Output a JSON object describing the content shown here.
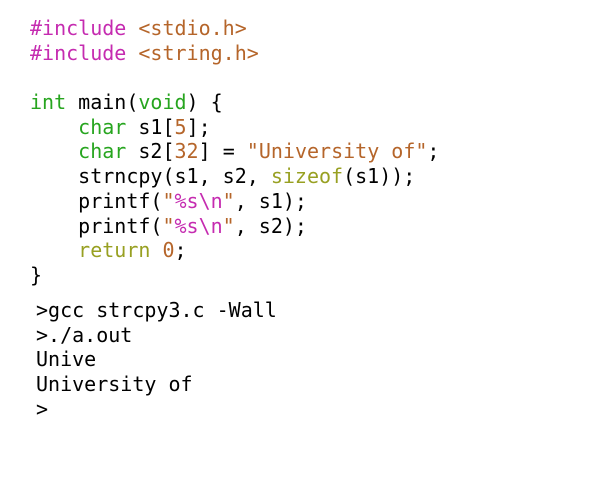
{
  "colors": {
    "preprocessor": "#c52bb0",
    "header": "#b5652a",
    "type": "#27a51f",
    "keyword": "#98a022",
    "string": "#b5652a",
    "escape": "#c52bb0",
    "number": "#b5652a",
    "text": "#000000",
    "background": "#ffffff"
  },
  "code": {
    "lines": [
      [
        {
          "kind": "preproc",
          "text": "#include "
        },
        {
          "kind": "header",
          "text": "<stdio.h>"
        }
      ],
      [
        {
          "kind": "preproc",
          "text": "#include "
        },
        {
          "kind": "header",
          "text": "<string.h>"
        }
      ],
      [],
      [
        {
          "kind": "type",
          "text": "int"
        },
        {
          "kind": "plain",
          "text": " main("
        },
        {
          "kind": "type",
          "text": "void"
        },
        {
          "kind": "plain",
          "text": ") {"
        }
      ],
      [
        {
          "kind": "plain",
          "text": "    "
        },
        {
          "kind": "type",
          "text": "char"
        },
        {
          "kind": "plain",
          "text": " s1["
        },
        {
          "kind": "number",
          "text": "5"
        },
        {
          "kind": "plain",
          "text": "];"
        }
      ],
      [
        {
          "kind": "plain",
          "text": "    "
        },
        {
          "kind": "type",
          "text": "char"
        },
        {
          "kind": "plain",
          "text": " s2["
        },
        {
          "kind": "number",
          "text": "32"
        },
        {
          "kind": "plain",
          "text": "] = "
        },
        {
          "kind": "string",
          "text": "\"University of\""
        },
        {
          "kind": "plain",
          "text": ";"
        }
      ],
      [
        {
          "kind": "plain",
          "text": "    strncpy(s1, s2, "
        },
        {
          "kind": "keyword",
          "text": "sizeof"
        },
        {
          "kind": "plain",
          "text": "(s1));"
        }
      ],
      [
        {
          "kind": "plain",
          "text": "    printf("
        },
        {
          "kind": "string",
          "text": "\""
        },
        {
          "kind": "escape",
          "text": "%s\\n"
        },
        {
          "kind": "string",
          "text": "\""
        },
        {
          "kind": "plain",
          "text": ", s1);"
        }
      ],
      [
        {
          "kind": "plain",
          "text": "    printf("
        },
        {
          "kind": "string",
          "text": "\""
        },
        {
          "kind": "escape",
          "text": "%s\\n"
        },
        {
          "kind": "string",
          "text": "\""
        },
        {
          "kind": "plain",
          "text": ", s2);"
        }
      ],
      [
        {
          "kind": "plain",
          "text": "    "
        },
        {
          "kind": "keyword",
          "text": "return"
        },
        {
          "kind": "plain",
          "text": " "
        },
        {
          "kind": "number",
          "text": "0"
        },
        {
          "kind": "plain",
          "text": ";"
        }
      ],
      [
        {
          "kind": "plain",
          "text": "}"
        }
      ]
    ]
  },
  "terminal": {
    "lines": [
      ">gcc strcpy3.c -Wall",
      ">./a.out",
      "Unive",
      "University of",
      ">"
    ]
  }
}
